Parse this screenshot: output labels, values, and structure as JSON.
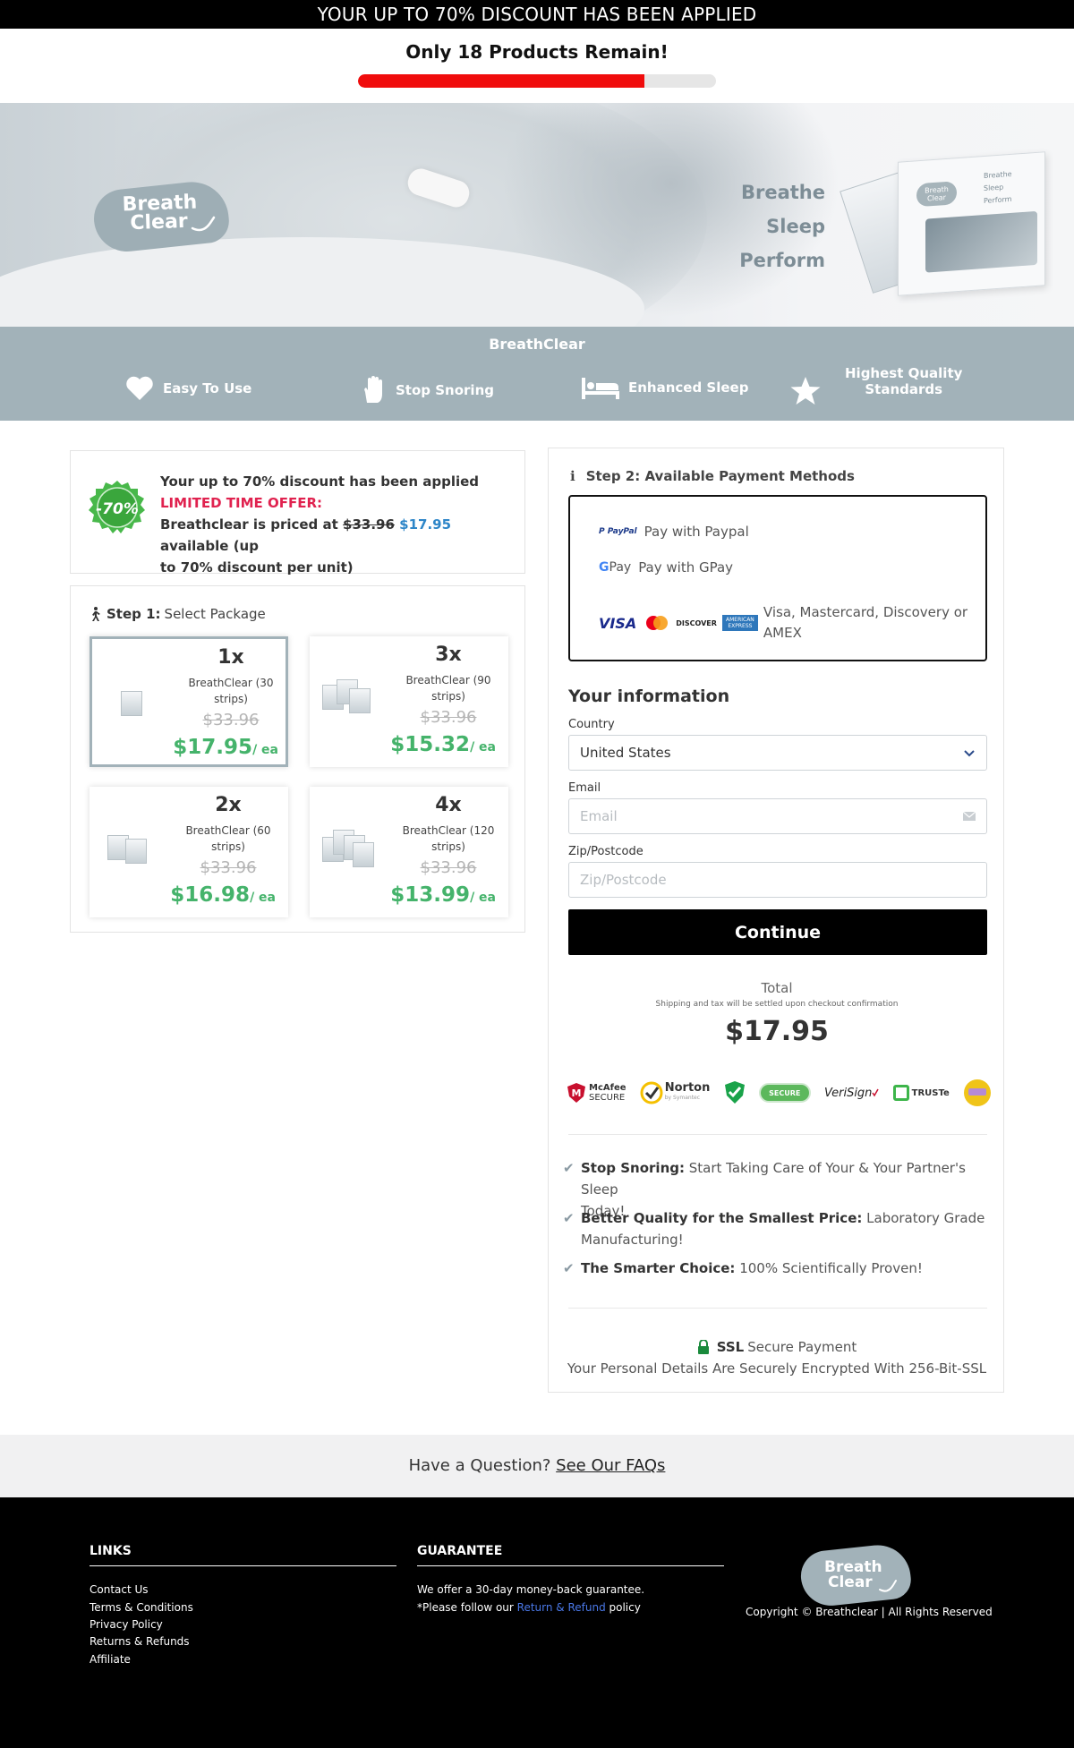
{
  "topbar": {
    "text": "YOUR UP TO 70% DISCOUNT HAS BEEN APPLIED"
  },
  "stock": {
    "headline": "Only 18 Products Remain!",
    "progress_percent": 80
  },
  "hero": {
    "logo_line1": "Breath",
    "logo_line2": "Clear",
    "taglines": [
      "Breathe",
      "Sleep",
      "Perform"
    ],
    "box_words": [
      "Breathe",
      "Sleep",
      "Perform"
    ]
  },
  "features": {
    "title": "BreathClear",
    "items": [
      {
        "label": "Easy To Use",
        "icon": "heart-icon"
      },
      {
        "label": "Stop Snoring",
        "icon": "hand-icon"
      },
      {
        "label": "Enhanced Sleep",
        "icon": "bed-icon"
      },
      {
        "label": "Highest Quality",
        "label2": "Standards",
        "icon": "star-icon"
      }
    ]
  },
  "discount": {
    "badge": "-70%",
    "line1": "Your up to 70% discount has been applied",
    "line2": "LIMITED TIME OFFER:",
    "line3_prefix": "Breathclear is priced at ",
    "old_price": "$33.96",
    "new_price": "$17.95",
    "line3_suffix": " available (up",
    "line4": "to 70% discount per unit)"
  },
  "packages": {
    "step_label": "Step 1:",
    "step_text": "Select Package",
    "unit_suffix": "/ ea",
    "items": [
      {
        "qty": "1x",
        "desc1": "BreathClear (30",
        "desc2": "strips)",
        "old": "$33.96",
        "price": "$17.95",
        "selected": true
      },
      {
        "qty": "3x",
        "desc1": "BreathClear (90",
        "desc2": "strips)",
        "old": "$33.96",
        "price": "$15.32",
        "selected": false
      },
      {
        "qty": "2x",
        "desc1": "BreathClear (60",
        "desc2": "strips)",
        "old": "$33.96",
        "price": "$16.98",
        "selected": false
      },
      {
        "qty": "4x",
        "desc1": "BreathClear (120",
        "desc2": "strips)",
        "old": "$33.96",
        "price": "$13.99",
        "selected": false
      }
    ]
  },
  "payment": {
    "step_label": "Step 2: Available Payment Methods",
    "paypal_logo": "PayPal",
    "paypal_label": "Pay with Paypal",
    "gpay_logo": "Pay",
    "gpay_label": "Pay with GPay",
    "cards_text": "Visa, Mastercard, Discovery or AMEX",
    "visa": "VISA",
    "discover": "DISCOVER",
    "amex": "AMERICAN EXPRESS"
  },
  "info": {
    "heading": "Your information",
    "country_label": "Country",
    "country_value": "United States",
    "email_label": "Email",
    "email_placeholder": "Email",
    "zip_label": "Zip/Postcode",
    "zip_placeholder": "Zip/Postcode",
    "continue_label": "Continue"
  },
  "total": {
    "label": "Total",
    "note": "Shipping and tax will be settled upon checkout confirmation",
    "amount": "$17.95"
  },
  "seals": {
    "mcafee1": "McAfee",
    "mcafee2": "SECURE",
    "norton": "Norton",
    "norton_sub": "by Symantec",
    "comodo": "SECURE",
    "verisign": "VeriSign",
    "truste": "TRUSTe"
  },
  "benefits": [
    {
      "title": "Stop Snoring:",
      "text1": " Start Taking Care of Your & Your Partner's Sleep",
      "text2": "Today!"
    },
    {
      "title": "Better Quality for the Smallest Price:",
      "text1": " Laboratory Grade",
      "text2": "Manufacturing!"
    },
    {
      "title": "The Smarter Choice:",
      "text1": " 100% Scientifically Proven!",
      "text2": ""
    }
  ],
  "ssl": {
    "title": "SSL",
    "text": "Secure Payment",
    "sub": "Your Personal Details Are Securely Encrypted With 256-Bit-SSL"
  },
  "faq": {
    "prefix": "Have a Question? ",
    "link": "See Our FAQs"
  },
  "footer": {
    "links_heading": "LINKS",
    "links": [
      "Contact Us",
      "Terms & Conditions",
      "Privacy Policy",
      "Returns & Refunds",
      "Affiliate"
    ],
    "guarantee_heading": "GUARANTEE",
    "guarantee_line1": "We offer a 30-day money-back guarantee.",
    "guarantee_line2_prefix": "*Please follow our ",
    "guarantee_link": "Return & Refund",
    "guarantee_line2_suffix": " policy",
    "logo_line1": "Breath",
    "logo_line2": "Clear",
    "copyright": "Copyright © Breathclear | All Rights Reserved"
  },
  "colors": {
    "accent_gray": "#a2b2b9",
    "price_green": "#45b36b",
    "alert_red": "#e0224f",
    "progress_red": "#f00c0c"
  }
}
